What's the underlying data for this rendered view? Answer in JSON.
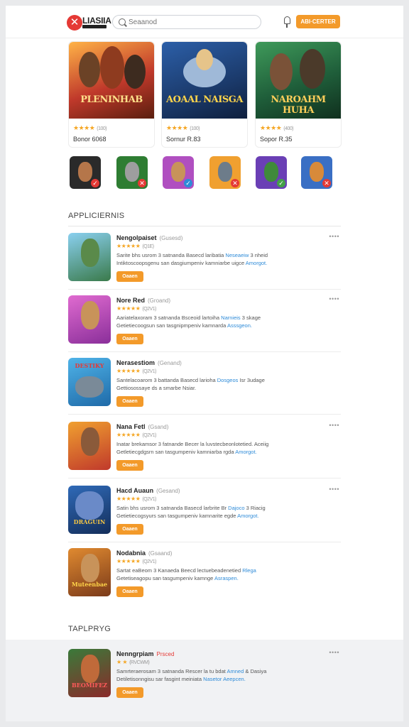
{
  "header": {
    "logo_glyph": "✕",
    "logo_text": "LIASIIA",
    "search_placeholder": "Seaanod",
    "cta_label": "ABI·CERTER"
  },
  "featured": [
    {
      "title": "PLENINHAB",
      "stars": "★★★★",
      "rating_count": "(100)",
      "name": "Bonor 6068"
    },
    {
      "title": "AOAAL NAISGA",
      "stars": "★★★★",
      "rating_count": "(100)",
      "name": "Sornur R.83"
    },
    {
      "title": "NAROAHM HUHA",
      "stars": "★★★★",
      "rating_count": "(400)",
      "name": "Sopor R.35"
    }
  ],
  "thumb_badges": [
    "✓",
    "✕",
    "✓",
    "✕",
    "✓",
    "✕"
  ],
  "sections": {
    "applications": "APPLICIERNIS",
    "popular": "TAPLPRYG"
  },
  "apps": [
    {
      "name": "Nengolpaiset",
      "dev": "(Gusesd)",
      "stars": "★★★★★",
      "rating_count": "(Q1E)",
      "desc": "Sarite bhs usrom 3 satnanda Basecd laribatia ",
      "link": "Neseaeiw",
      "desc2": " 3 nheid",
      "desc3": "Intiktoscoopsgenu san dasgiumpeniv kamniarbe uigce ",
      "link2": "Amorgot.",
      "button": "Oaaen",
      "icon_text": ""
    },
    {
      "name": "Nore Red",
      "dev": "(Groand)",
      "stars": "★★★★★",
      "rating_count": "(Q2V1)",
      "desc": "Aariatelaxoram 3 satnanda Bsceoid lartoiha ",
      "link": "Narnieis",
      "desc2": " 3 skage",
      "desc3": "Getietiecoogsun san tasgnipmpeniv kamnarda ",
      "link2": "Asssgeon.",
      "button": "Oaaen",
      "icon_text": ""
    },
    {
      "name": "Nerasestiom",
      "dev": "(Genand)",
      "stars": "★★★★★",
      "rating_count": "(Q2V1)",
      "desc": "Santelacoarom 3 battanda Basecd larioha ",
      "link": "Dosgeos",
      "desc2": " Isr 3udage",
      "desc3": "Gettiosossaye ds a smarbe Nsiar.",
      "link2": "",
      "button": "Oaaen",
      "icon_text": "DESTIKY"
    },
    {
      "name": "Nana Fetl",
      "dev": "(Gsand)",
      "stars": "★★★★★",
      "rating_count": "(Q2V1)",
      "desc": "Inatar brekamsor 3 fatnande Becer la luvstecbeonlotetied. Aceiig",
      "link": "",
      "desc2": "",
      "desc3": "Getletiecgdgsrn san tasgumpeniv kamniarba rgda ",
      "link2": "Amorgot.",
      "button": "Oaaen",
      "icon_text": ""
    },
    {
      "name": "Hacd Auaun",
      "dev": "(Gesand)",
      "stars": "★★★★★",
      "rating_count": "(Q2V1)",
      "desc": "Satin bhs usrom 3 satnanda Basecd larbrite Br ",
      "link": "Dajoco",
      "desc2": " 3 Riacig",
      "desc3": "Getietiecogsyurs san tasgumpeniv kamnarite egde ",
      "link2": "Amorgot.",
      "button": "Oaaen",
      "icon_text": "DRAGUIN"
    },
    {
      "name": "Nodabnia",
      "dev": "(Gsaand)",
      "stars": "★★★★★",
      "rating_count": "(Q2V1)",
      "desc": "Sartat eaBeom 3 Kanaeda Beecd lectuebeadenetied ",
      "link": "Rlega",
      "desc2": "",
      "desc3": "Getetiseagopu san tasgumpeniv kamnge ",
      "link2": "Asraspen.",
      "button": "Oaaen",
      "icon_text": "Muteenbae"
    }
  ],
  "popular": [
    {
      "name": "Nenngrpiam",
      "dev": "Prsced",
      "stars": "★ ★",
      "rating_count": "(RVCWM)",
      "desc": "Samrteraerosam 3 satnanda Rescer la tu bdat ",
      "link": "Amned",
      "desc2": " & Dasiya",
      "desc3": "Detiletisonngisu sar fasgint meiniata ",
      "link2": "Nasetor Aeepcen.",
      "button": "Oaaen",
      "icon_text": "BEOMIFEZ"
    }
  ],
  "colors": {
    "accent": "#f39a2a",
    "link": "#2e8bd8",
    "star": "#f5a623"
  }
}
